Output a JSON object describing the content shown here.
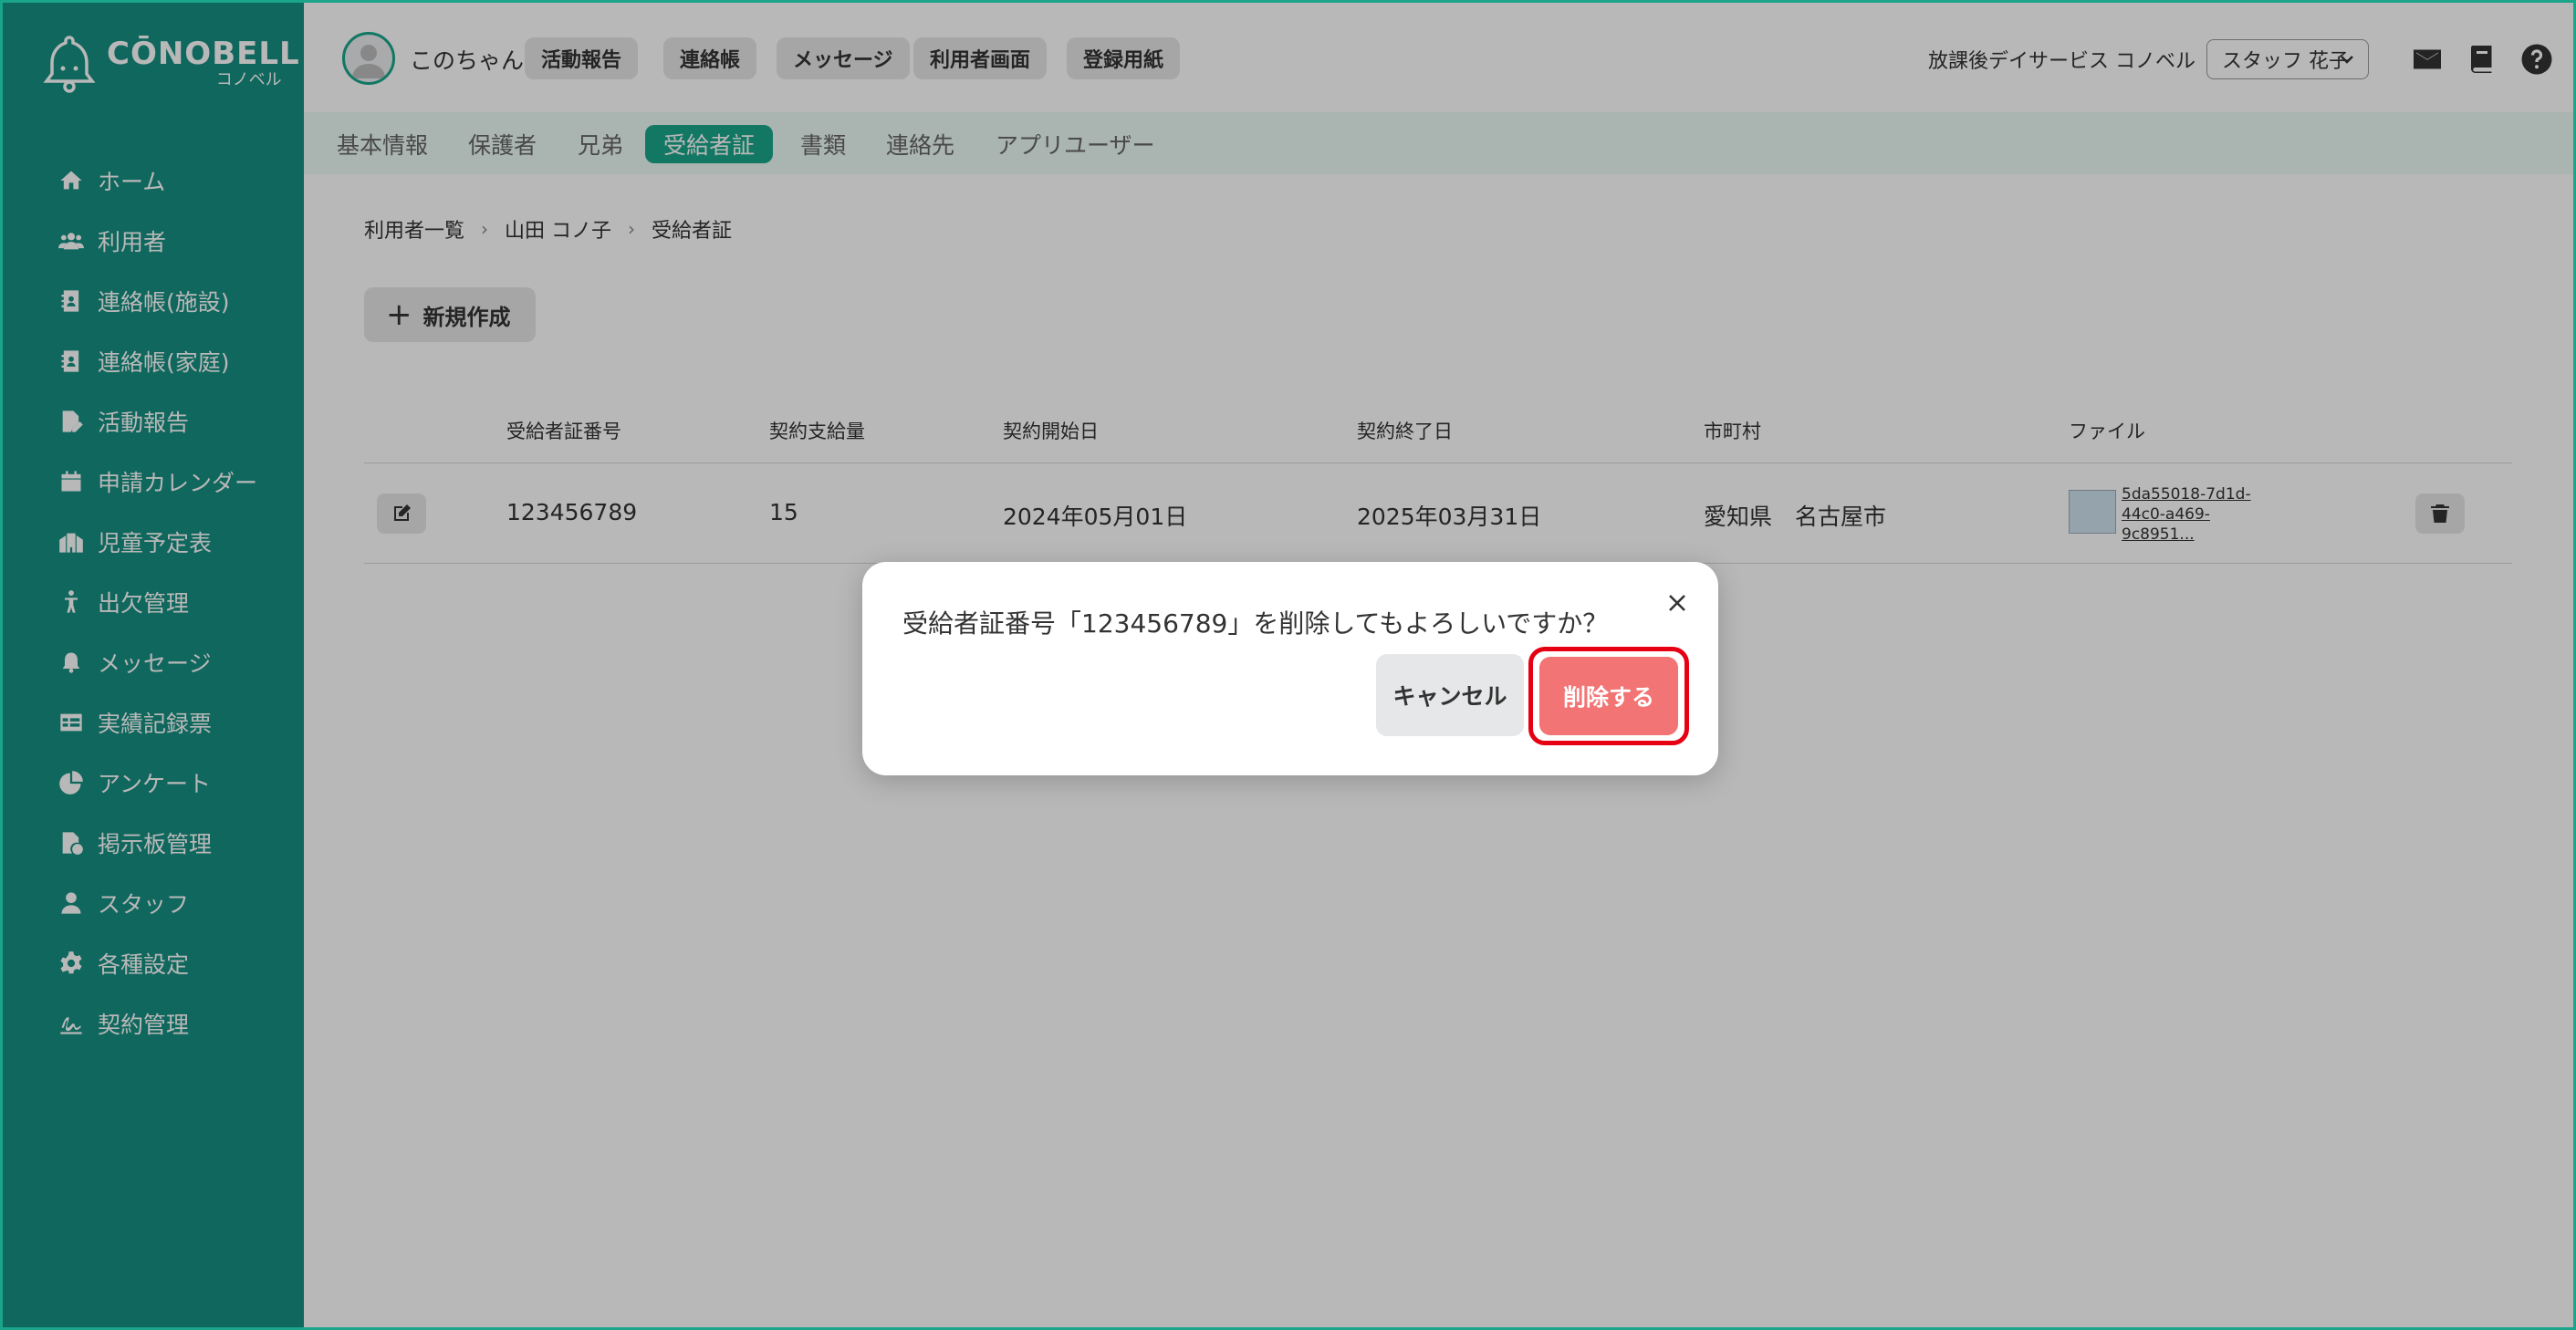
{
  "app": {
    "logo_main": "CŌNOBELL",
    "logo_sub": "コノベル"
  },
  "sidebar": {
    "items": [
      {
        "label": "ホーム",
        "icon": "home-icon"
      },
      {
        "label": "利用者",
        "icon": "users-icon"
      },
      {
        "label": "連絡帳(施設)",
        "icon": "contact-book-icon"
      },
      {
        "label": "連絡帳(家庭)",
        "icon": "contact-book-icon"
      },
      {
        "label": "活動報告",
        "icon": "report-icon"
      },
      {
        "label": "申請カレンダー",
        "icon": "calendar-icon"
      },
      {
        "label": "児童予定表",
        "icon": "schedule-icon"
      },
      {
        "label": "出欠管理",
        "icon": "attendance-icon"
      },
      {
        "label": "メッセージ",
        "icon": "bell-icon"
      },
      {
        "label": "実績記録票",
        "icon": "table-icon"
      },
      {
        "label": "アンケート",
        "icon": "pie-chart-icon"
      },
      {
        "label": "掲示板管理",
        "icon": "file-check-icon"
      },
      {
        "label": "スタッフ",
        "icon": "staff-icon"
      },
      {
        "label": "各種設定",
        "icon": "gear-icon"
      },
      {
        "label": "契約管理",
        "icon": "signature-icon"
      }
    ]
  },
  "header": {
    "user_name": "このちゃん",
    "pills": [
      "活動報告",
      "連絡帳",
      "メッセージ",
      "利用者画面",
      "登録用紙"
    ],
    "facility": "放課後デイサービス コノベル",
    "staff_select": "スタッフ 花子"
  },
  "tabs": [
    "基本情報",
    "保護者",
    "兄弟",
    "受給者証",
    "書類",
    "連絡先",
    "アプリユーザー"
  ],
  "active_tab": "受給者証",
  "breadcrumb": [
    "利用者一覧",
    "山田 コノ子",
    "受給者証"
  ],
  "new_button": "新規作成",
  "table": {
    "headers": [
      "受給者証番号",
      "契約支給量",
      "契約開始日",
      "契約終了日",
      "市町村",
      "ファイル"
    ],
    "rows": [
      {
        "number": "123456789",
        "amount": "15",
        "start": "2024年05月01日",
        "end": "2025年03月31日",
        "city": "愛知県　名古屋市",
        "file": "5da55018-7d1d-44c0-a469-9c8951..."
      }
    ]
  },
  "modal": {
    "message": "受給者証番号「123456789」を削除してもよろしいですか？",
    "cancel": "キャンセル",
    "delete": "削除する"
  },
  "colors": {
    "sidebar_bg": "#168f82",
    "accent": "#1aa58a",
    "delete": "#f27474",
    "highlight": "#e60012"
  }
}
